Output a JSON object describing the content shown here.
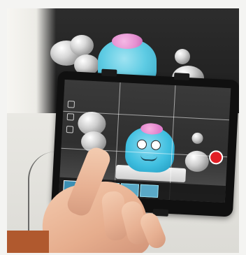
{
  "scene": {
    "subject": "photo",
    "colors": {
      "backdrop": "#232323",
      "table": "#e2e1dc",
      "creature": "#5dcbe3",
      "creature_hair": "#e48fd0",
      "record_button": "#e21f26",
      "tablet": "#101010",
      "skin": "#e6ad8d",
      "sleeve": "#b0592e"
    }
  },
  "tablet_screen": {
    "icons": [
      "record-button-icon",
      "grid-overlay-icon",
      "frame-thumbnail-icon"
    ]
  }
}
